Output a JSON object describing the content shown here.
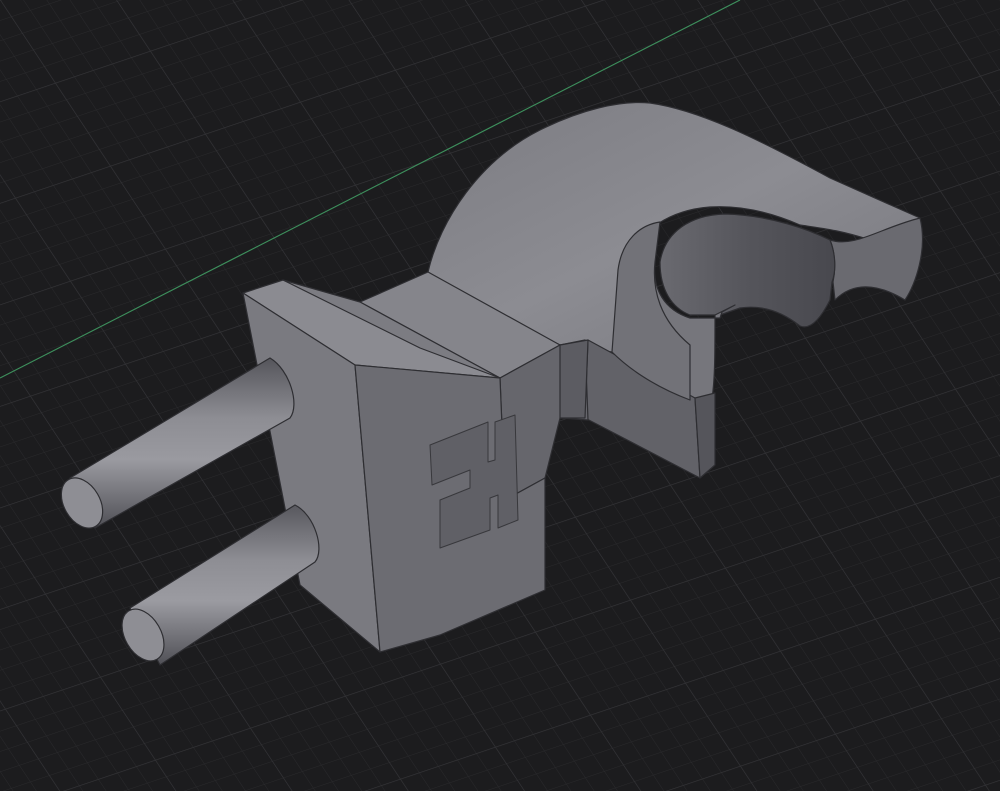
{
  "viewport": {
    "background": "#1c1c1e",
    "grid_visible": true,
    "grid_minor_color": "#2a2a2c",
    "grid_major_color": "#353537",
    "axis_x_color": "#3d8f5c"
  },
  "model": {
    "material_colors": {
      "top": "#8a8a90",
      "front": "#6e6e74",
      "side": "#5c5c62",
      "dark": "#4a4a50",
      "edge": "#2e2e32"
    }
  }
}
